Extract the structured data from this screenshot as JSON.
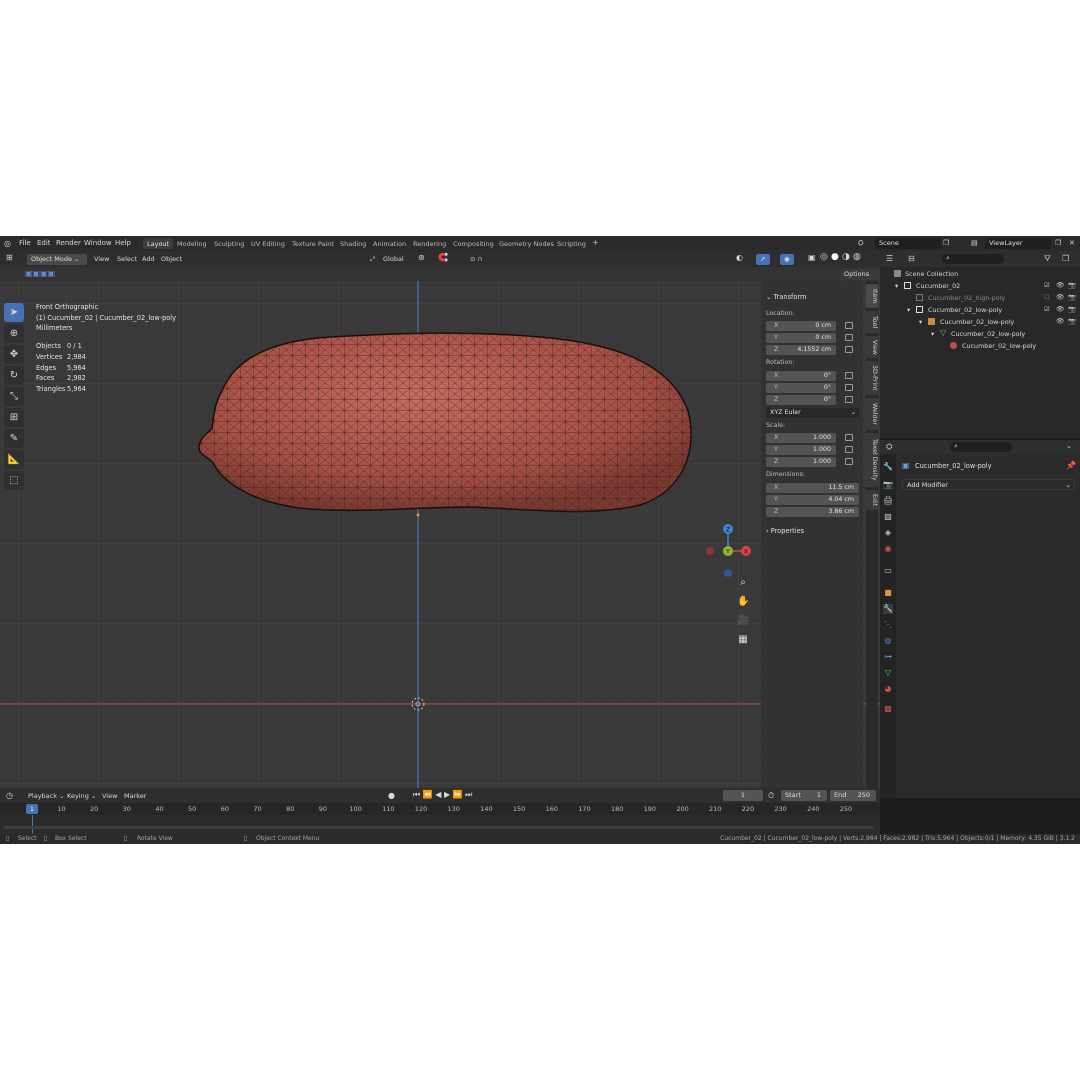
{
  "menu": [
    "File",
    "Edit",
    "Render",
    "Window",
    "Help"
  ],
  "workspaces": [
    {
      "label": "Layout",
      "active": true
    },
    {
      "label": "Modeling"
    },
    {
      "label": "Sculpting"
    },
    {
      "label": "UV Editing"
    },
    {
      "label": "Texture Paint"
    },
    {
      "label": "Shading"
    },
    {
      "label": "Animation"
    },
    {
      "label": "Rendering"
    },
    {
      "label": "Compositing"
    },
    {
      "label": "Geometry Nodes"
    },
    {
      "label": "Scripting"
    }
  ],
  "add_workspace": "+",
  "scene": {
    "name": "Scene",
    "view_layer": "ViewLayer"
  },
  "viewport": {
    "mode": "Object Mode",
    "menu": [
      "View",
      "Select",
      "Add",
      "Object"
    ],
    "transform_orientation": "Global",
    "options": "Options",
    "view_name": "Front Orthographic",
    "active_object": "(1) Cucumber_02 | Cucumber_02_low-poly",
    "units": "Millimeters",
    "stats": [
      {
        "k": "Objects",
        "v": "0 / 1"
      },
      {
        "k": "Vertices",
        "v": "2,984"
      },
      {
        "k": "Edges",
        "v": "5,964"
      },
      {
        "k": "Faces",
        "v": "2,982"
      },
      {
        "k": "Triangles",
        "v": "5,964"
      }
    ],
    "gizmo": {
      "z": "Z",
      "y": "Y",
      "x": "X"
    }
  },
  "transform": {
    "title": "Transform",
    "location_label": "Location:",
    "location": [
      {
        "a": "X",
        "v": "0 cm"
      },
      {
        "a": "Y",
        "v": "0 cm"
      },
      {
        "a": "Z",
        "v": "4.1552 cm"
      }
    ],
    "rotation_label": "Rotation:",
    "rotation": [
      {
        "a": "X",
        "v": "0°"
      },
      {
        "a": "Y",
        "v": "0°"
      },
      {
        "a": "Z",
        "v": "0°"
      }
    ],
    "rotation_mode": "XYZ Euler",
    "scale_label": "Scale:",
    "scale": [
      {
        "a": "X",
        "v": "1.000"
      },
      {
        "a": "Y",
        "v": "1.000"
      },
      {
        "a": "Z",
        "v": "1.000"
      }
    ],
    "dimensions_label": "Dimensions:",
    "dimensions": [
      {
        "a": "X",
        "v": "11.5 cm"
      },
      {
        "a": "Y",
        "v": "4.04 cm"
      },
      {
        "a": "Z",
        "v": "3.86 cm"
      }
    ],
    "properties": "Properties"
  },
  "side_tabs": [
    "Item",
    "Tool",
    "View",
    "3D-Print",
    "Welder",
    "Texel Density",
    "Edit"
  ],
  "outliner": {
    "collection": "Scene Collection",
    "items": [
      {
        "name": "Cucumber_02"
      },
      {
        "name": "Cucumber_02_high-poly"
      },
      {
        "name": "Cucumber_02_low-poly"
      },
      {
        "name": "Cucumber_02_low-poly"
      },
      {
        "name": "Cucumber_02_low-poly"
      },
      {
        "name": "Cucumber_02_low-poly"
      }
    ]
  },
  "properties": {
    "object": "Cucumber_02_low-poly",
    "add_modifier": "Add Modifier"
  },
  "timeline": {
    "menu": [
      "Playback",
      "Keying",
      "View",
      "Marker"
    ],
    "current_frame": "1",
    "start_label": "Start",
    "start": "1",
    "end_label": "End",
    "end": "250",
    "ticks": [
      "1",
      "10",
      "20",
      "30",
      "40",
      "50",
      "60",
      "70",
      "80",
      "90",
      "100",
      "110",
      "120",
      "130",
      "140",
      "150",
      "160",
      "170",
      "180",
      "190",
      "200",
      "210",
      "220",
      "230",
      "240",
      "250"
    ]
  },
  "status": {
    "select": "Select",
    "box_select": "Box Select",
    "rotate": "Rotate View",
    "context": "Object Context Menu",
    "info": "Cucumber_02 | Cucumber_02_low-poly | Verts:2,984 | Faces:2,982 | Tris:5,964 | Objects:0/1 | Memory: 4.35 GiB | 3.1.2"
  },
  "colors": {
    "mesh": "#b25a4e",
    "wire": "#2a1512",
    "accent": "#4772b3",
    "axis_x": "#d64646",
    "axis_y": "#8cbb2d",
    "axis_z": "#3d85d6"
  }
}
